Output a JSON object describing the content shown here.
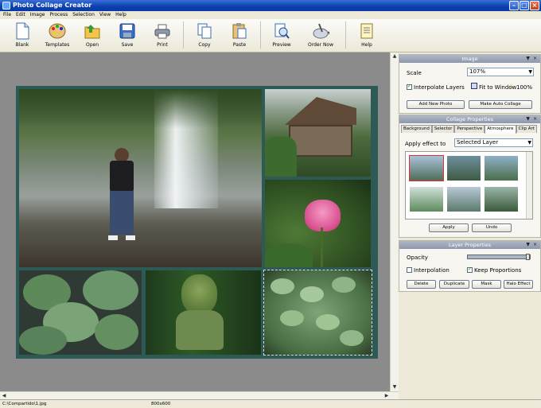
{
  "app": {
    "title": "Photo Collage Creator"
  },
  "menu": [
    "File",
    "Edit",
    "Image",
    "Process",
    "Selection",
    "View",
    "Help"
  ],
  "toolbar": {
    "blank": "Blank",
    "templates": "Templates",
    "open": "Open",
    "save": "Save",
    "print": "Print",
    "copy": "Copy",
    "paste": "Paste",
    "preview": "Preview",
    "order_now": "Order Now",
    "help": "Help"
  },
  "image_panel": {
    "title": "Image",
    "scale_label": "Scale",
    "scale_value": "107%",
    "interpolate_label": "Interpolate Layers",
    "fit_label": "Fit to Window",
    "hundred_label": "100%",
    "add_photo": "Add New Photo",
    "make_collage": "Make Auto Collage"
  },
  "collage_panel": {
    "title": "Collage Properties",
    "tabs": [
      "Background",
      "Selector",
      "Perspective",
      "Atmosphere",
      "Clip Art"
    ],
    "active_tab": "Atmosphere",
    "apply_label": "Apply effect to",
    "apply_value": "Selected Layer",
    "apply_btn": "Apply",
    "undo_btn": "Undo"
  },
  "layer_panel": {
    "title": "Layer Properties",
    "opacity_label": "Opacity",
    "opacity_fraction": 1.0,
    "interpolation_label": "Interpolation",
    "keep_label": "Keep Proportions",
    "delete": "Delete",
    "duplicate": "Duplicate",
    "mask": "Mask",
    "halo": "Halo Effect"
  },
  "status": {
    "path": "C:\\Compartido\\1.jpg",
    "size": "800x600"
  },
  "colors": {
    "collage_border": "#2e5a55",
    "canvas_bg": "#8b8b8b",
    "panel_header": "#97a2b6"
  }
}
